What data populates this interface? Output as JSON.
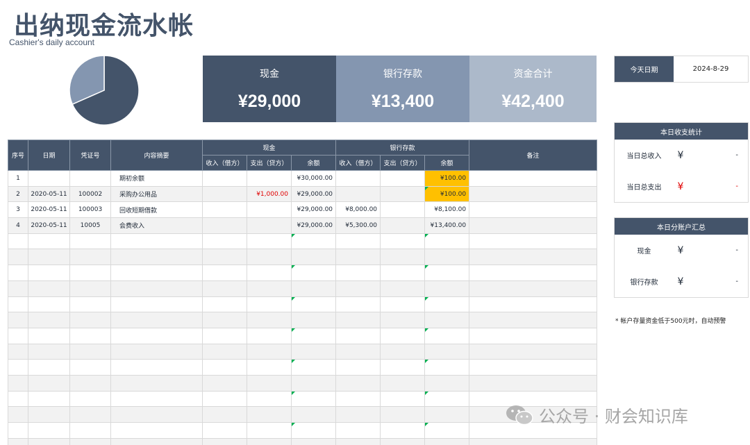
{
  "header": {
    "title": "出纳现金流水帐",
    "subtitle": "Cashier's daily account"
  },
  "pie": {
    "slices": [
      {
        "label": "现金",
        "value": 29000,
        "color": "#44546a"
      },
      {
        "label": "银行存款",
        "value": 13400,
        "color": "#8496b0"
      }
    ]
  },
  "kpis": {
    "cash": {
      "label": "现金",
      "value": "¥29,000"
    },
    "bank": {
      "label": "银行存款",
      "value": "¥13,400"
    },
    "total": {
      "label": "资金合计",
      "value": "¥42,400"
    }
  },
  "today": {
    "label": "今天日期",
    "value": "2024-8-29"
  },
  "daily_stats": {
    "title": "本日收支统计",
    "income_label": "当日总收入",
    "income_symbol": "¥",
    "income_value": "-",
    "expense_label": "当日总支出",
    "expense_symbol": "¥",
    "expense_value": "-"
  },
  "account_summary": {
    "title": "本日分账户汇总",
    "cash_label": "现金",
    "cash_symbol": "¥",
    "cash_value": "-",
    "bank_label": "银行存款",
    "bank_symbol": "¥",
    "bank_value": "-"
  },
  "note": "* 帐户存量资金低于500元时，自动预警",
  "table": {
    "headers": {
      "seq": "序号",
      "date": "日期",
      "voucher": "凭证号",
      "summary": "内容摘要",
      "cash": "现金",
      "bank": "银行存款",
      "remark": "备注",
      "cash_in": "收入（借方）",
      "cash_out": "支出（贷方）",
      "cash_bal": "余额",
      "bank_in": "收入（借方）",
      "bank_out": "支出（贷方）",
      "bank_bal": "余额"
    },
    "rows": [
      {
        "seq": "1",
        "date": "",
        "voucher": "",
        "summary": "期初余额",
        "cash_in": "",
        "cash_out": "",
        "cash_bal": "¥30,000.00",
        "bank_in": "",
        "bank_out": "",
        "bank_bal": "¥100.00",
        "remark": ""
      },
      {
        "seq": "2",
        "date": "2020-05-11",
        "voucher": "100002",
        "summary": "采购办公用品",
        "cash_in": "",
        "cash_out": "¥1,000.00",
        "cash_bal": "¥29,000.00",
        "bank_in": "",
        "bank_out": "",
        "bank_bal": "¥100.00",
        "remark": ""
      },
      {
        "seq": "3",
        "date": "2020-05-11",
        "voucher": "100003",
        "summary": "回收短期借款",
        "cash_in": "",
        "cash_out": "",
        "cash_bal": "¥29,000.00",
        "bank_in": "¥8,000.00",
        "bank_out": "",
        "bank_bal": "¥8,100.00",
        "remark": ""
      },
      {
        "seq": "4",
        "date": "2020-05-11",
        "voucher": "10005",
        "summary": "会费收入",
        "cash_in": "",
        "cash_out": "",
        "cash_bal": "¥29,000.00",
        "bank_in": "¥5,300.00",
        "bank_out": "",
        "bank_bal": "¥13,400.00",
        "remark": ""
      }
    ],
    "empty_rows": 14
  },
  "watermark": {
    "text": "公众号 · 财会知识库",
    "icon": "wechat-icon"
  }
}
